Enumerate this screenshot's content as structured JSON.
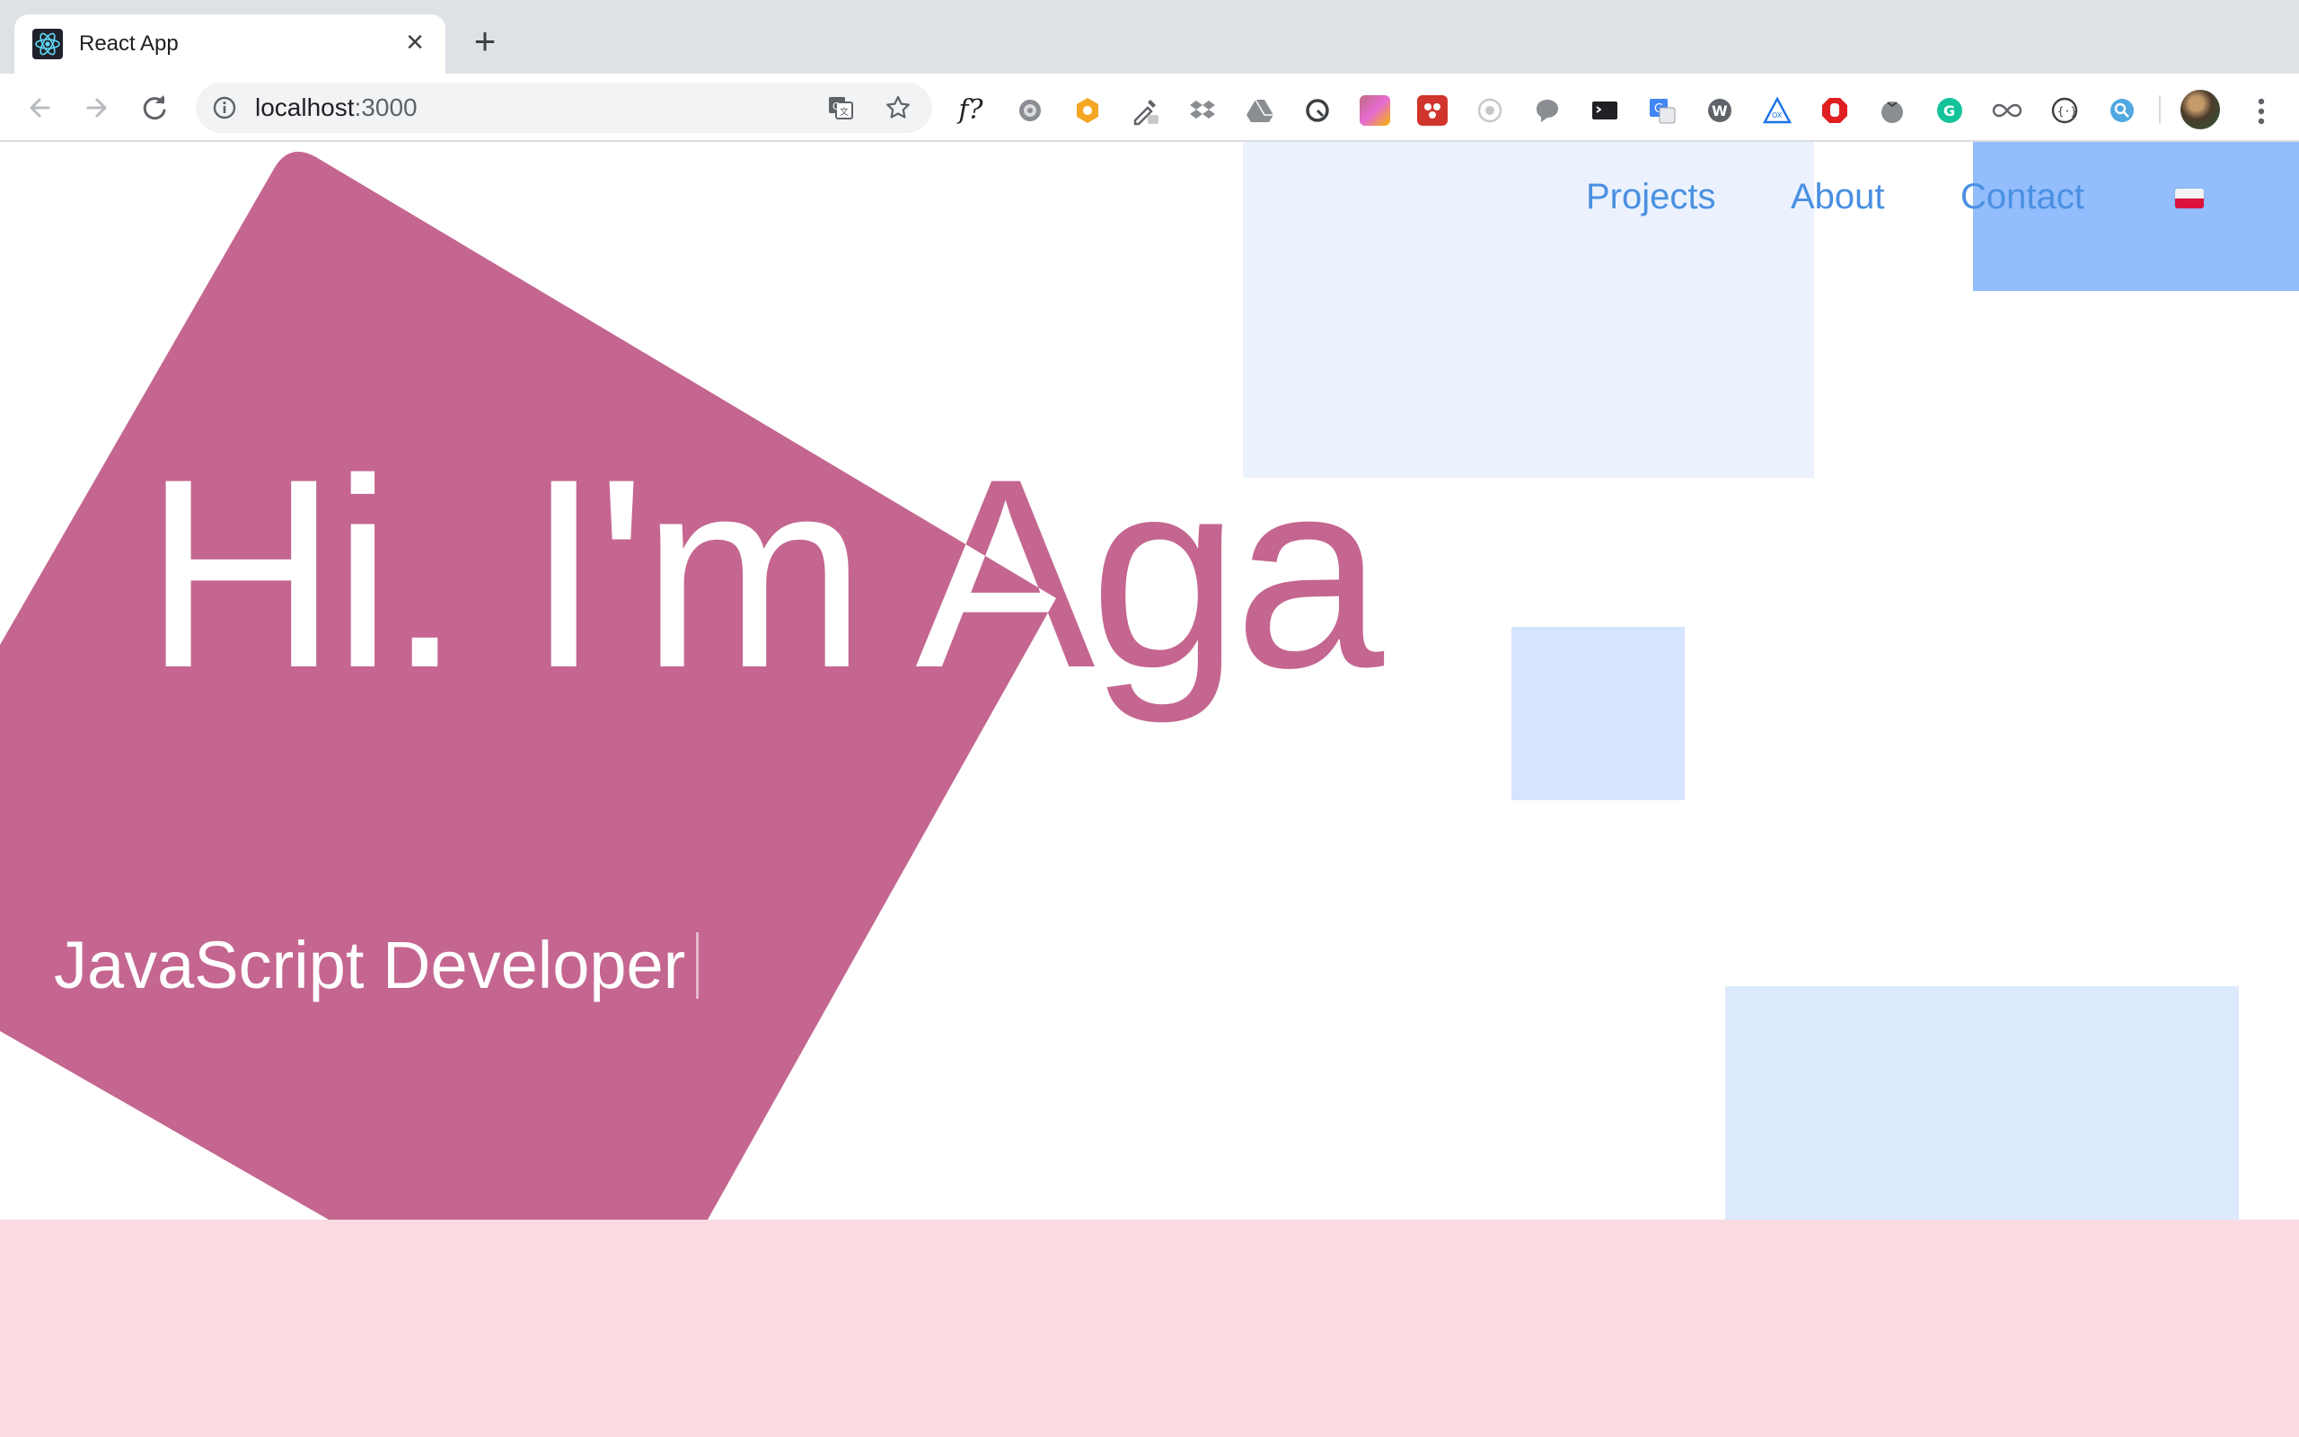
{
  "browser": {
    "tab_title": "React App",
    "tab_close": "×",
    "new_tab": "+",
    "url_host": "localhost",
    "url_port": ":3000",
    "extensions": [
      "translate-icon",
      "star-icon",
      "f-question-icon",
      "gear-extension-icon",
      "orange-gear-extension-icon",
      "eyedropper-icon",
      "dropbox-icon",
      "drive-icon",
      "sync-icon",
      "gradient-extension-icon",
      "red-extension-icon",
      "radio-extension-icon",
      "chat-bubble-icon",
      "terminal-icon",
      "google-translate-icon",
      "w-extension-icon",
      "triangle-extension-icon",
      "stop-hand-icon",
      "tomato-icon",
      "grammarly-icon",
      "infinity-icon",
      "json-viewer-icon",
      "search-extension-icon"
    ],
    "ext_f_label": "f?"
  },
  "page": {
    "nav": {
      "projects": "Projects",
      "about": "About",
      "contact": "Contact",
      "language_flag": "polish-flag-icon"
    },
    "hero_title": "Hi. I'm Aga",
    "subtitle": "JavaScript Developer"
  },
  "colors": {
    "accent_pink": "#c4668f",
    "link_blue": "#4a90e2",
    "footer_pink": "#fadbe2",
    "light_blue": "#ebf2fe",
    "mid_blue": "#93bdfc"
  }
}
